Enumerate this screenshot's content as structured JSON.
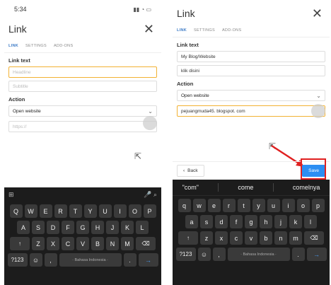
{
  "left": {
    "status_time": "5:34",
    "status_icons": "▮▮ ◔ ▭",
    "title": "Link",
    "close_glyph": "✕",
    "tabs": [
      "LINK",
      "SETTINGS",
      "ADD-ONS"
    ],
    "link_text_label": "Link text",
    "headline_placeholder": "Headline",
    "subtitle_placeholder": "Subtitle",
    "action_label": "Action",
    "action_value": "Open website",
    "url_placeholder": "https://",
    "keyboard": {
      "toolbar_left": "⊞",
      "toolbar_right": "🎤  ⌕",
      "row1": [
        "Q",
        "W",
        "E",
        "R",
        "T",
        "Y",
        "U",
        "I",
        "O",
        "P"
      ],
      "row2": [
        "A",
        "S",
        "D",
        "F",
        "G",
        "H",
        "J",
        "K",
        "L"
      ],
      "row3": [
        "↑",
        "Z",
        "X",
        "C",
        "V",
        "B",
        "N",
        "M",
        "⌫"
      ],
      "row4": [
        "?123",
        "☺",
        ",",
        "· Bahasa Indonesia ·",
        ".",
        "→"
      ]
    }
  },
  "right": {
    "title": "Link",
    "close_glyph": "✕",
    "tabs": [
      "LINK",
      "SETTINGS",
      "ADD-ONS"
    ],
    "link_text_label": "Link text",
    "headline_value": "My Blog/Website",
    "subtitle_value": "klik disini",
    "action_label": "Action",
    "action_value": "Open website",
    "url_value": "pejuangmuda45. blogspot. com",
    "back_label": "Back",
    "save_label": "Save",
    "keyboard": {
      "suggestions": [
        "\"com\"",
        "come",
        "comelnya"
      ],
      "row1": [
        "q",
        "w",
        "e",
        "r",
        "t",
        "y",
        "u",
        "i",
        "o",
        "p"
      ],
      "row2": [
        "a",
        "s",
        "d",
        "f",
        "g",
        "h",
        "j",
        "k",
        "l"
      ],
      "row3": [
        "↑",
        "z",
        "x",
        "c",
        "v",
        "b",
        "n",
        "m",
        "⌫"
      ],
      "row4": [
        "?123",
        "☺",
        ",",
        "· Bahasa Indonesia ·",
        ".",
        "→"
      ]
    }
  },
  "colors": {
    "accent": "#3b7ac6",
    "save": "#2c8ef2",
    "highlight": "#e02020",
    "focus": "#f2b233"
  }
}
